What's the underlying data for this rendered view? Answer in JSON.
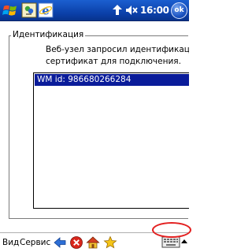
{
  "titlebar": {
    "clock": "16:00",
    "ok_label": "ok",
    "icons": [
      "windows-start-icon",
      "messenger-icon",
      "internet-explorer-icon",
      "connectivity-icon",
      "volume-muted-icon"
    ]
  },
  "identification": {
    "group_title": "Идентификация",
    "message_lines": [
      "Веб-узел запросил идентификацию",
      "сертификат для подключения."
    ],
    "certificates": [
      {
        "label": "WM id: 986680266284",
        "selected": true
      }
    ]
  },
  "menubar": {
    "view_label": "Вид",
    "service_label": "Сервис",
    "icons": [
      "back-arrow-icon",
      "stop-icon",
      "home-icon",
      "favorites-star-icon",
      "keyboard-icon",
      "sip-arrow-icon"
    ]
  },
  "colors": {
    "titlebar": "#0a3ea6",
    "selection": "#0a1c9a",
    "annotation": "#e32020"
  }
}
